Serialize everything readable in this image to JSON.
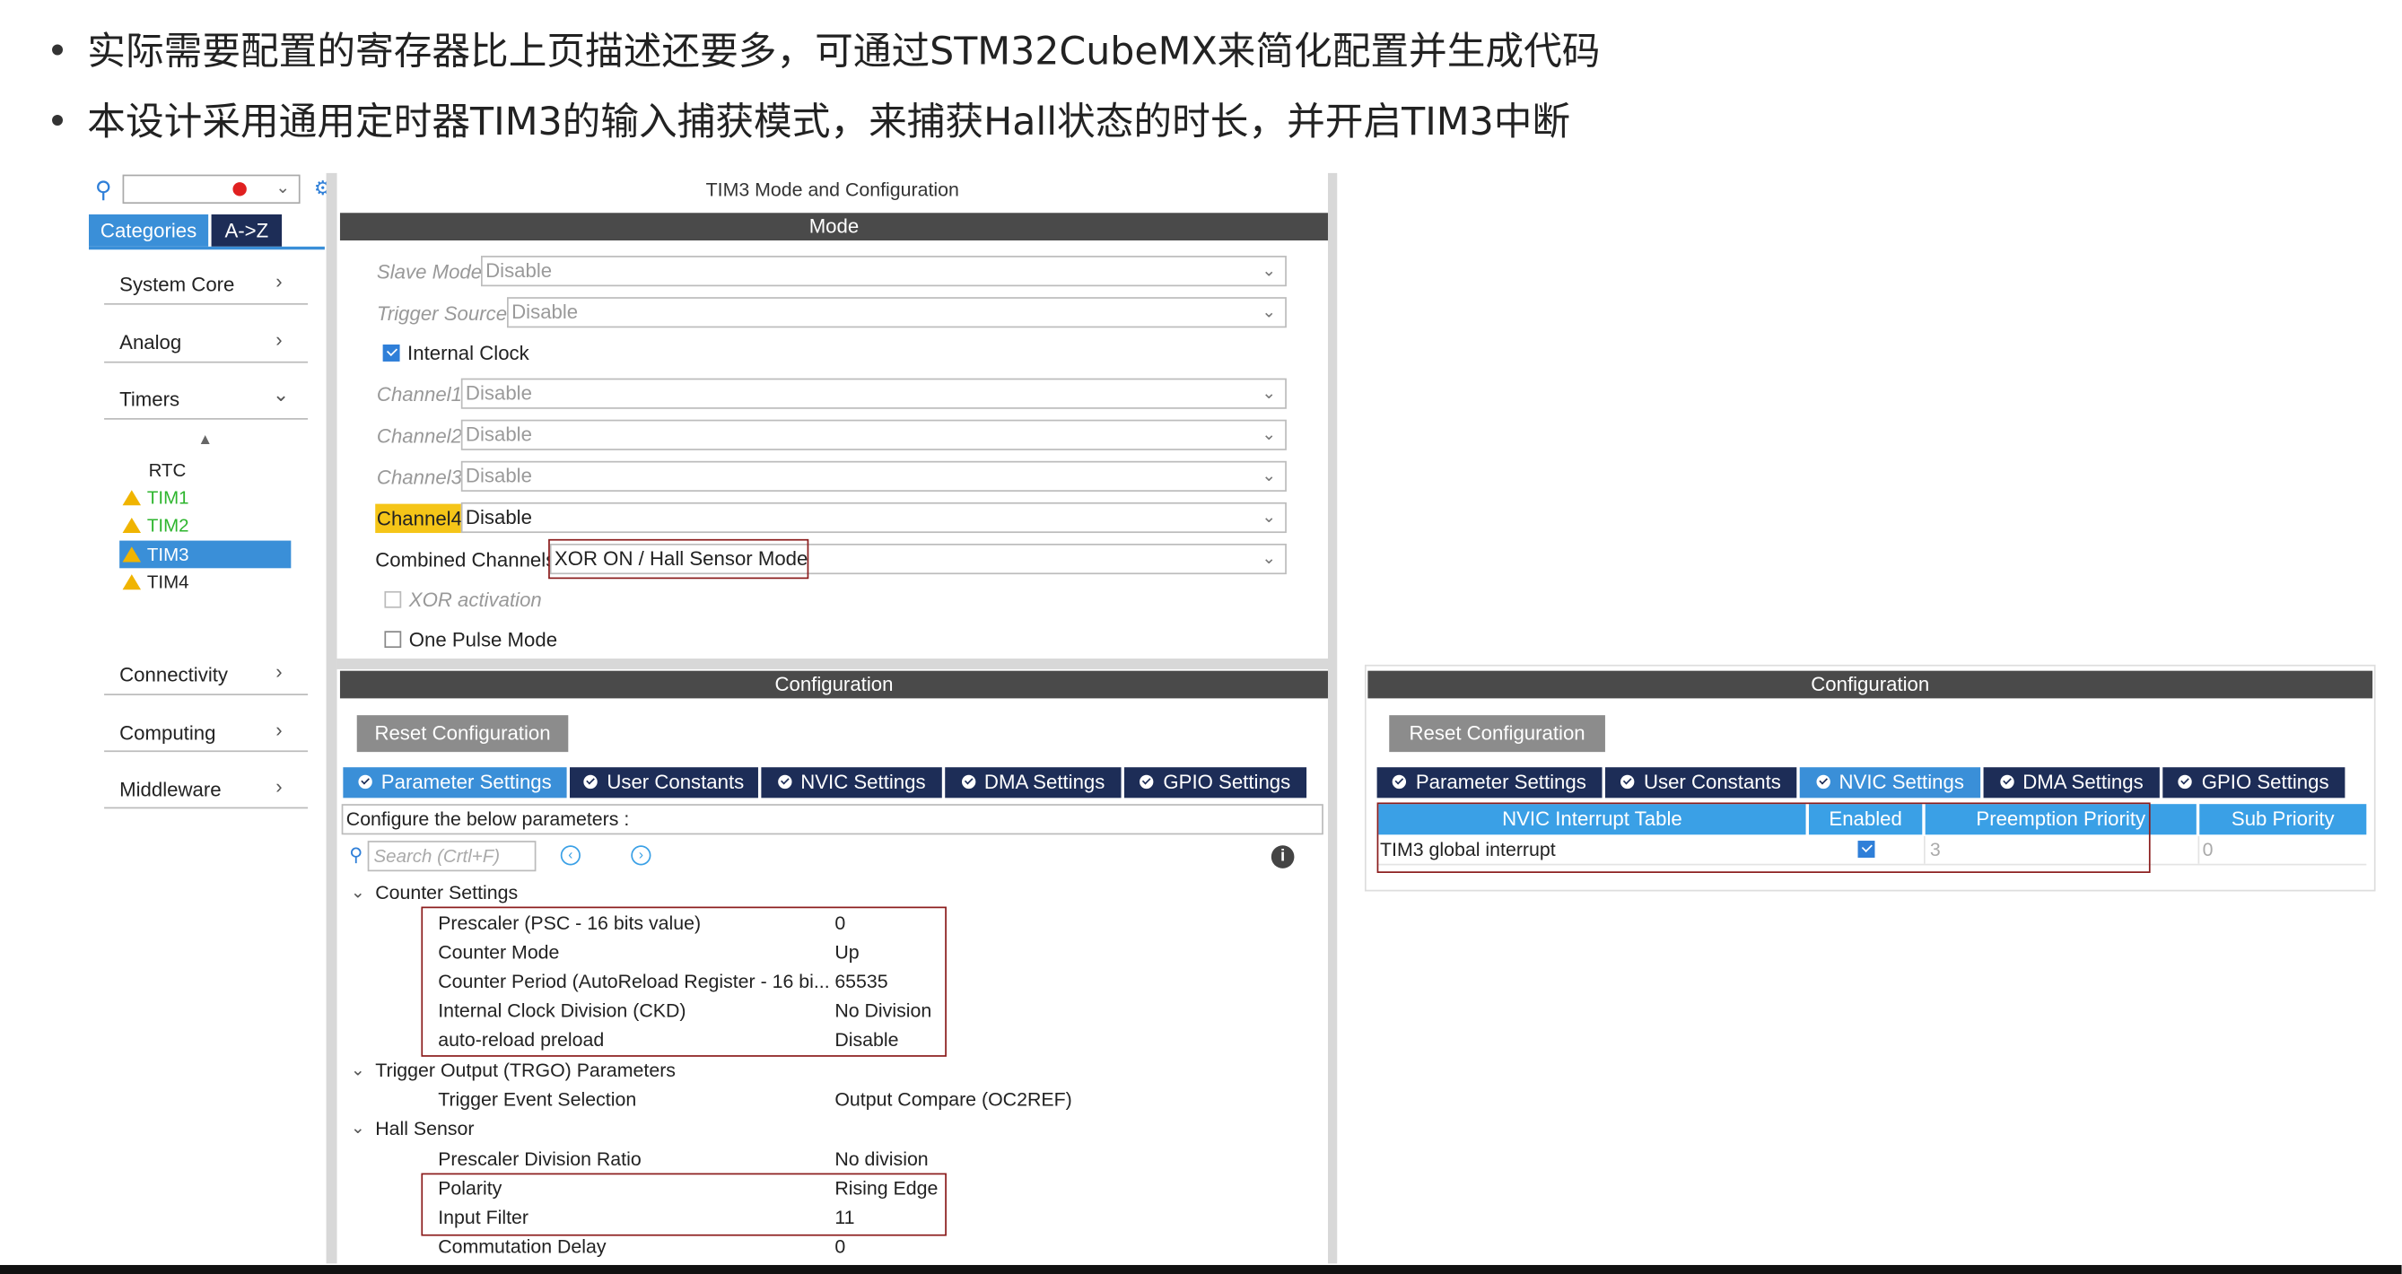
{
  "bullets": [
    "实际需要配置的寄存器比上页描述还要多，可通过STM32CubeMX来简化配置并生成代码",
    "本设计采用通用定时器TIM3的输入捕获模式，来捕获Hall状态的时长，并开启TIM3中断"
  ],
  "sidebar": {
    "tabs": [
      "Categories",
      "A->Z"
    ],
    "items": [
      "System Core",
      "Analog",
      "Timers",
      "Connectivity",
      "Computing",
      "Middleware"
    ],
    "timers": [
      "RTC",
      "TIM1",
      "TIM2",
      "TIM3",
      "TIM4"
    ]
  },
  "panel": {
    "title": "TIM3 Mode and Configuration",
    "mode_header": "Mode",
    "config_header": "Configuration",
    "slave_mode_label": "Slave Mode",
    "slave_mode_value": "Disable",
    "trigger_source_label": "Trigger Source",
    "trigger_source_value": "Disable",
    "internal_clock_label": "Internal Clock",
    "channel1_label": "Channel1",
    "channel1_value": "Disable",
    "channel2_label": "Channel2",
    "channel2_value": "Disable",
    "channel3_label": "Channel3",
    "channel3_value": "Disable",
    "channel4_label": "Channel4",
    "channel4_value": "Disable",
    "combined_label": "Combined Channels",
    "combined_value": "XOR ON / Hall Sensor Mode",
    "xor_label": "XOR activation",
    "one_pulse_label": "One Pulse Mode",
    "reset_label": "Reset Configuration",
    "tabs": [
      "Parameter Settings",
      "User Constants",
      "NVIC Settings",
      "DMA Settings",
      "GPIO Settings"
    ],
    "configure_text": "Configure the below parameters :",
    "search_placeholder": "Search (Crtl+F)",
    "counter_settings": "Counter Settings",
    "params": [
      {
        "name": "Prescaler (PSC - 16 bits value)",
        "value": "0"
      },
      {
        "name": "Counter Mode",
        "value": "Up"
      },
      {
        "name": "Counter Period (AutoReload Register - 16 bi...",
        "value": "65535"
      },
      {
        "name": "Internal Clock Division (CKD)",
        "value": "No Division"
      },
      {
        "name": "auto-reload preload",
        "value": "Disable"
      }
    ],
    "trgo_header": "Trigger Output (TRGO) Parameters",
    "trgo_param": {
      "name": "Trigger Event Selection",
      "value": "Output Compare (OC2REF)"
    },
    "hall_header": "Hall Sensor",
    "hall_params": [
      {
        "name": "Prescaler Division Ratio",
        "value": "No division"
      },
      {
        "name": "Polarity",
        "value": "Rising Edge"
      },
      {
        "name": "Input Filter",
        "value": "11"
      },
      {
        "name": "Commutation Delay",
        "value": "0"
      }
    ]
  },
  "right_panel": {
    "config_header": "Configuration",
    "reset_label": "Reset Configuration",
    "tabs": [
      "Parameter Settings",
      "User Constants",
      "NVIC Settings",
      "DMA Settings",
      "GPIO Settings"
    ],
    "columns": [
      "NVIC Interrupt Table",
      "Enabled",
      "Preemption Priority",
      "Sub Priority"
    ],
    "row": {
      "name": "TIM3 global interrupt",
      "preemption": "3",
      "sub": "0"
    }
  },
  "colors": {
    "accent": "#3a8fd8",
    "dark_tab": "#1d2d57",
    "red_box": "#8b1c1c",
    "highlight": "#f5c518"
  }
}
